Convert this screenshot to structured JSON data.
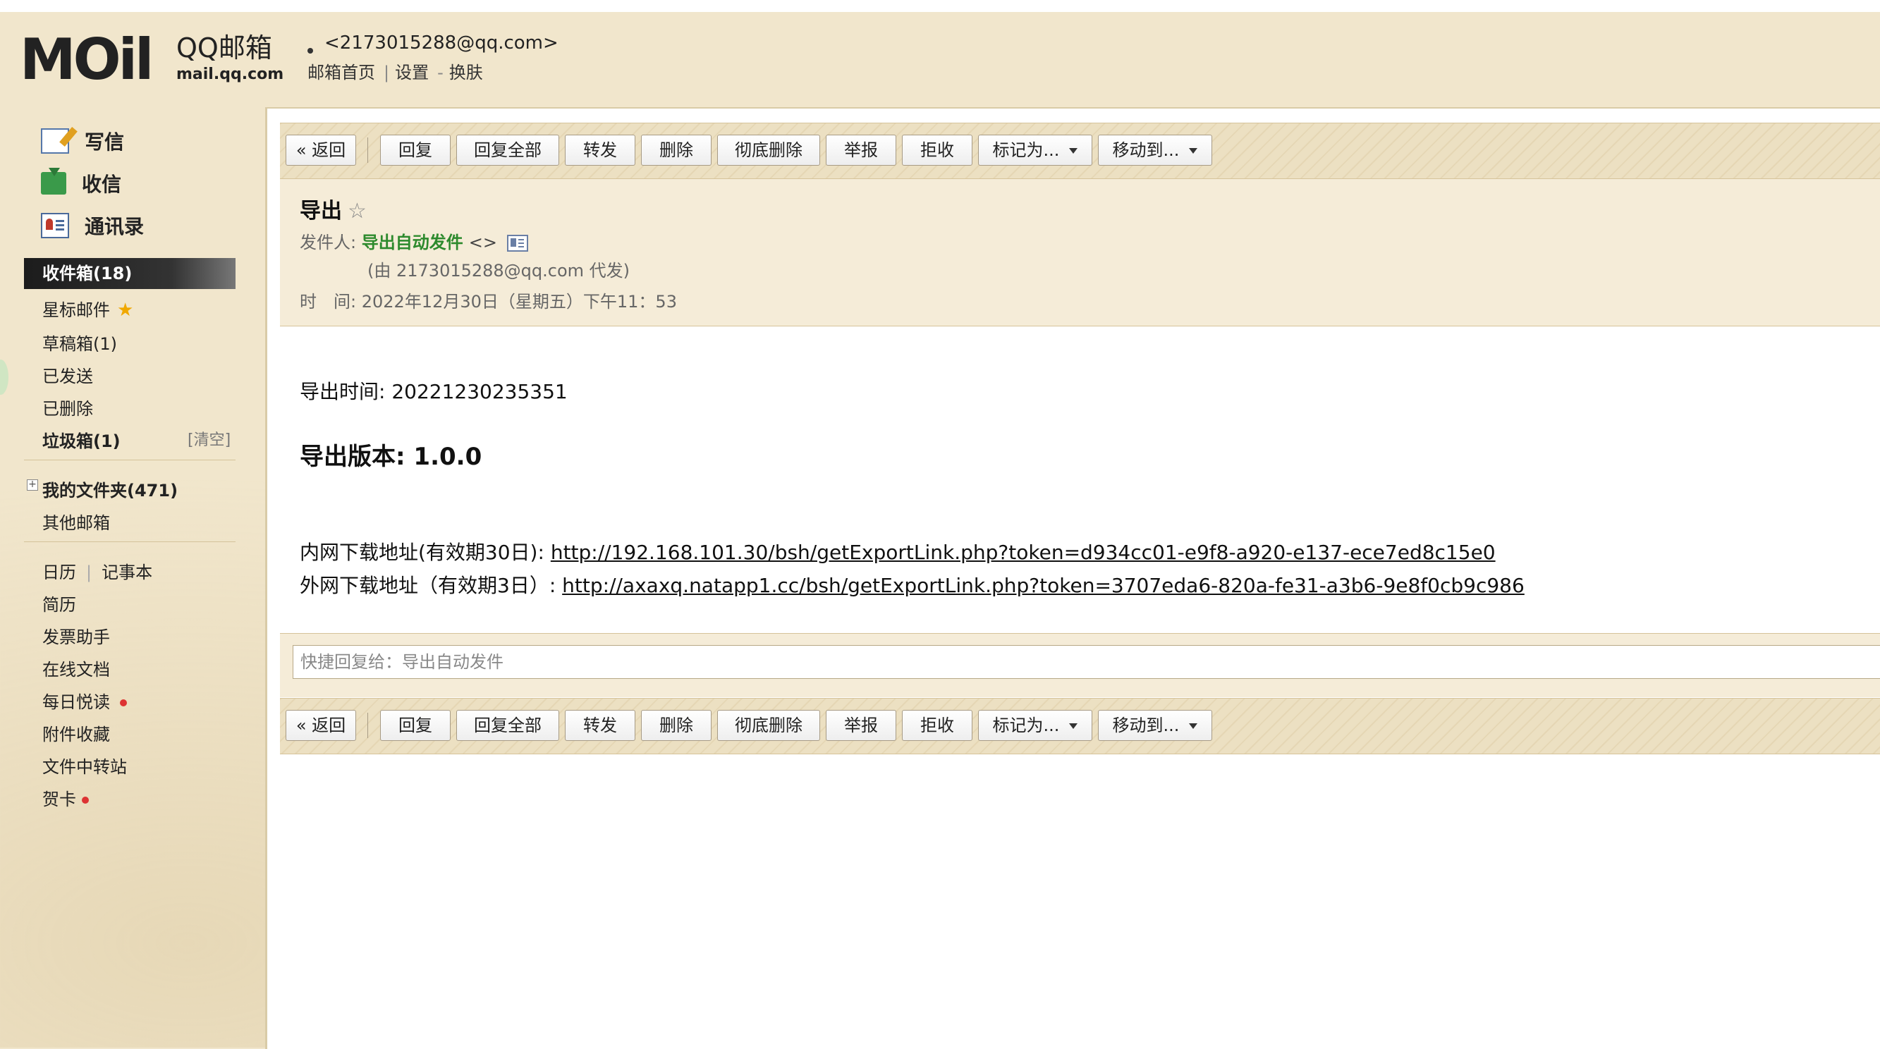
{
  "header": {
    "logo_text": "MOil",
    "logo_brand": "QQ邮箱",
    "logo_domain": "mail.qq.com",
    "account_email": "<2173015288@qq.com>",
    "link_home": "邮箱首页",
    "link_sep": "|",
    "link_settings": "设置",
    "link_dash": "-",
    "link_skin": "换肤"
  },
  "sidebar": {
    "actions": {
      "write": "写信",
      "receive": "收信",
      "contacts": "通讯录"
    },
    "folders": {
      "inbox": "收件箱(18)",
      "starred": "星标邮件",
      "starred_icon": "★",
      "drafts": "草稿箱(1)",
      "sent": "已发送",
      "deleted": "已删除",
      "spam": "垃圾箱(1)",
      "clear": "[清空]",
      "my_folders": "我的文件夹(471)",
      "expand": "+",
      "other_mailboxes": "其他邮箱"
    },
    "apps": {
      "calendar": "日历",
      "sep": "|",
      "notes": "记事本",
      "resume": "简历",
      "invoice": "发票助手",
      "docs": "在线文档",
      "daily_read": "每日悦读",
      "attachments": "附件收藏",
      "file_transfer": "文件中转站",
      "cards": "贺卡"
    }
  },
  "toolbar": {
    "back": "« 返回",
    "reply": "回复",
    "reply_all": "回复全部",
    "forward": "转发",
    "delete": "删除",
    "perm_delete": "彻底删除",
    "report": "举报",
    "reject": "拒收",
    "mark_as": "标记为...",
    "move_to": "移动到..."
  },
  "mail": {
    "subject": "导出",
    "star_icon": "☆",
    "sender_label": "发件人:",
    "sender_name": "导出自动发件",
    "sender_addr": "<>",
    "on_behalf": "(由 2173015288@qq.com 代发)",
    "time_label": "时　间:",
    "time_value": "2022年12月30日（星期五）下午11：53",
    "body": {
      "export_time": "导出时间: 20221230235351",
      "export_version": "导出版本: 1.0.0",
      "intranet_label": "内网下载地址(有效期30日):",
      "intranet_url": "http://192.168.101.30/bsh/getExportLink.php?token=d934cc01-e9f8-a920-e137-ece7ed8c15e0",
      "internet_label": "外网下载地址（有效期3日）:",
      "internet_url": "http://axaxq.natapp1.cc/bsh/getExportLink.php?token=3707eda6-820a-fe31-a3b6-9e8f0cb9c986"
    }
  },
  "quick_reply": {
    "placeholder": "快捷回复给：导出自动发件"
  },
  "colors": {
    "sender_green": "#2d8a2d",
    "inbox_active_bg": "#1c1c1c",
    "unread_dot": "#dd3333",
    "star_gold": "#f0a800"
  }
}
